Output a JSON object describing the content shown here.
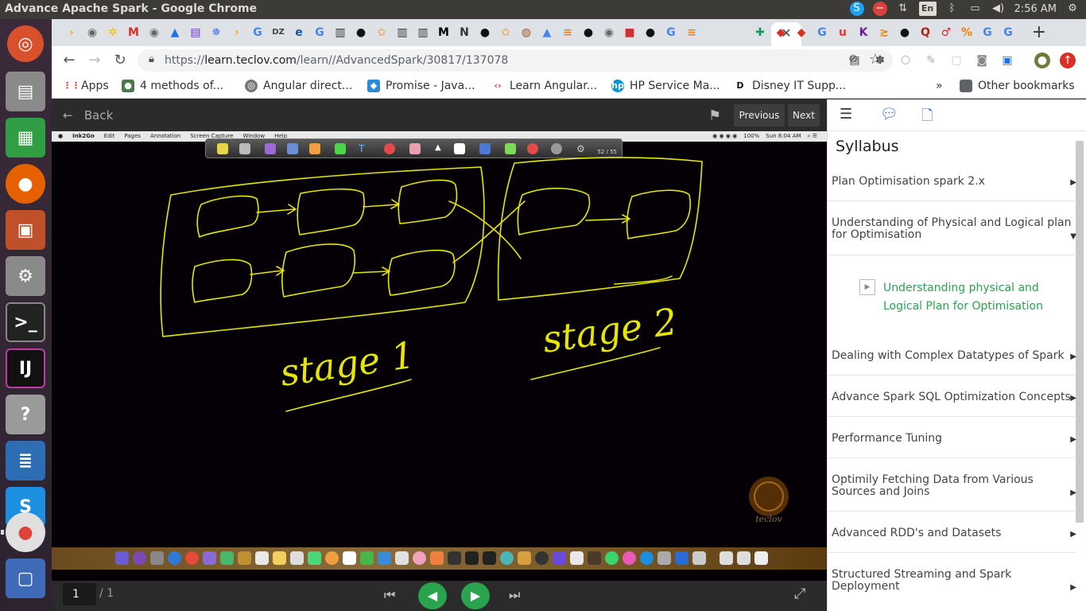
{
  "window": {
    "title": "Advance Apache Spark - Google Chrome"
  },
  "system_tray": {
    "input_method": "En",
    "clock": "2:56 AM"
  },
  "browser": {
    "url_prefix": "https://",
    "url_domain": "learn.teclov.com",
    "url_path": "/learn//AdvancedSpark/30817/137078",
    "bookmarks": [
      {
        "label": "Apps"
      },
      {
        "label": "4 methods of..."
      },
      {
        "label": "Angular direct..."
      },
      {
        "label": "Promise - Java..."
      },
      {
        "label": "Learn Angular..."
      },
      {
        "label": "HP Service Ma..."
      },
      {
        "label": "Disney IT Supp..."
      }
    ],
    "more_bookmarks": "»",
    "other_bookmarks": "Other bookmarks"
  },
  "player": {
    "back_label": "Back",
    "previous_label": "Previous",
    "next_label": "Next",
    "page_current": "1",
    "page_total": "/ 1"
  },
  "slide": {
    "menubar_items": [
      "Ink2Go",
      "Edit",
      "Pages",
      "Annotation",
      "Screen Capture",
      "Window",
      "Help"
    ],
    "menubar_right": [
      "100%",
      "Sun 8:04 AM"
    ],
    "toolbar_counter": "52 / 55",
    "watermark_text": "teclov",
    "stage1_label": "stage 1",
    "stage2_label": "stage 2"
  },
  "syllabus": {
    "title": "Syllabus",
    "sections": [
      {
        "label": "Plan Optimisation spark 2.x",
        "expanded": false
      },
      {
        "label": "Understanding of Physical and Logical plan for Optimisation",
        "expanded": true
      },
      {
        "label": "Dealing with Complex Datatypes of Spark",
        "expanded": false
      },
      {
        "label": "Advance Spark SQL Optimization Concepts",
        "expanded": false
      },
      {
        "label": "Performance Tuning",
        "expanded": false
      },
      {
        "label": "Optimily Fetching Data from Various Sources and Joins",
        "expanded": false
      },
      {
        "label": "Advanced RDD's and Datasets",
        "expanded": false
      },
      {
        "label": "Structured Streaming and Spark Deployment",
        "expanded": false
      }
    ],
    "active_lesson": "Understanding physical and Logical Plan for Optimisation"
  },
  "colors": {
    "accent": "#2aa34f",
    "ink": "#e6e600",
    "slide_bg": "#040006"
  }
}
